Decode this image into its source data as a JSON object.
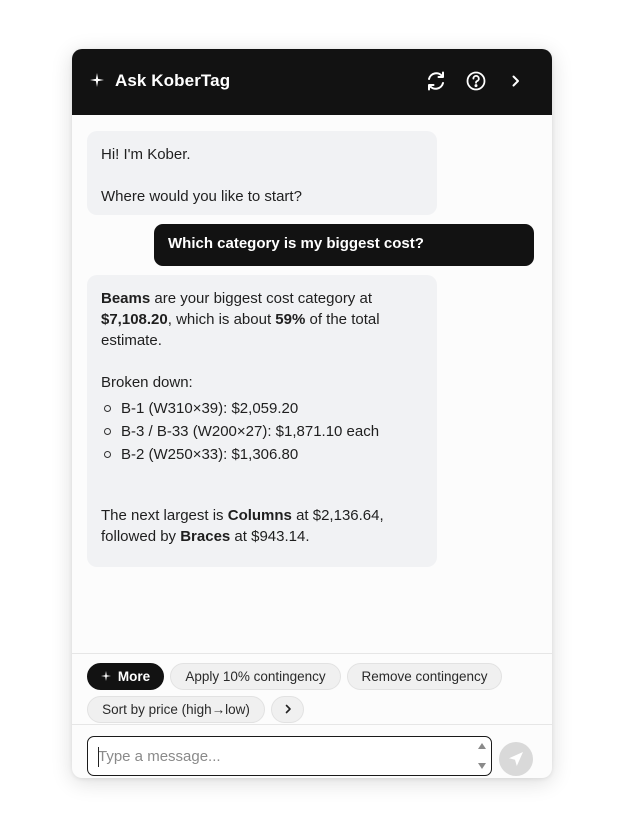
{
  "header": {
    "title": "Ask KoberTag",
    "icons": [
      "sparkle-icon",
      "refresh-icon",
      "help-icon",
      "chevron-right-icon"
    ]
  },
  "messages": {
    "greeting_line1": "Hi! I'm Kober.",
    "greeting_line2": "Where would you like to start?",
    "user_question": "Which category is my biggest cost?",
    "answer": {
      "s1_bold": "Beams",
      "s1_text": " are your biggest cost category at ",
      "s1_amount": "$7,108.20",
      "s1_text2": ", which is about ",
      "s1_percent": "59%",
      "s1_text3": " of the total estimate.",
      "breakdown_label": "Broken down:",
      "items": [
        "B-1 (W310×39): $2,059.20",
        "B-3 / B-33 (W200×27): $1,871.10 each",
        "B-2 (W250×33): $1,306.80"
      ],
      "s2_text": "The next largest is ",
      "s2_bold1": "Columns",
      "s2_text2": " at $2,136.64, followed by ",
      "s2_bold2": "Braces",
      "s2_text3": " at $943.14."
    }
  },
  "suggestions": {
    "more_label": "More",
    "chips": [
      "Apply 10% contingency",
      "Remove contingency",
      "Sort by price (high→low)"
    ],
    "next_icon": "chevron-right-icon"
  },
  "composer": {
    "placeholder": "Type a message...",
    "send_icon": "send-icon"
  },
  "colors": {
    "header_bg": "#121212",
    "bot_bubble_bg": "#f1f2f4",
    "user_bubble_bg": "#121212",
    "send_button_bg": "#d9d9d9"
  }
}
